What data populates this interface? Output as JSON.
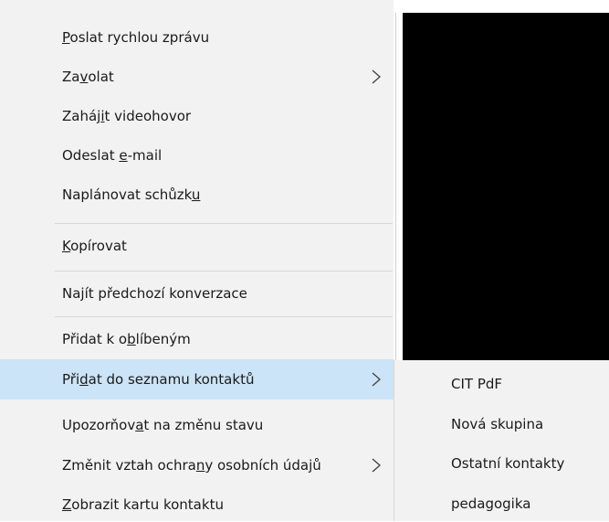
{
  "menu": {
    "items": [
      {
        "label": "Poslat rychlou zprávu",
        "accel": "P",
        "submenu": false
      },
      {
        "label": "Zavolat",
        "accel": "v",
        "submenu": true
      },
      {
        "label": "Zahájit videohovor",
        "accel": "t",
        "submenu": false
      },
      {
        "label": "Odeslat e-mail",
        "accel": "e",
        "submenu": false
      },
      {
        "label": "Naplánovat schůzku",
        "accel": "u",
        "submenu": false
      },
      {
        "label": "Kopírovat",
        "accel": "K",
        "submenu": false
      },
      {
        "label": "Najít předchozí konverzace",
        "accel": "j",
        "submenu": false
      },
      {
        "label": "Přidat k oblíbeným",
        "accel": "o",
        "submenu": false
      },
      {
        "label": "Přidat do seznamu kontaktů",
        "accel": "d",
        "submenu": true,
        "highlighted": true
      },
      {
        "label": "Upozorňovat na změnu stavu",
        "accel": "t",
        "submenu": false
      },
      {
        "label": "Změnit vztah ochrany osobních údajů",
        "accel": "c",
        "submenu": true
      },
      {
        "label": "Zobrazit kartu kontaktu",
        "accel": "Z",
        "submenu": false
      }
    ]
  },
  "submenu": {
    "items": [
      {
        "label": "CIT PdF"
      },
      {
        "label": "Nová skupina"
      },
      {
        "label": "Ostatní kontakty"
      },
      {
        "label": "pedagogika"
      }
    ]
  },
  "colors": {
    "menu_bg": "#f2f2f2",
    "highlight": "#cce4f7",
    "separator": "#d7d7d7",
    "black_panel": "#000000"
  },
  "icons": {
    "submenu_arrow": "chevron-right-icon"
  }
}
